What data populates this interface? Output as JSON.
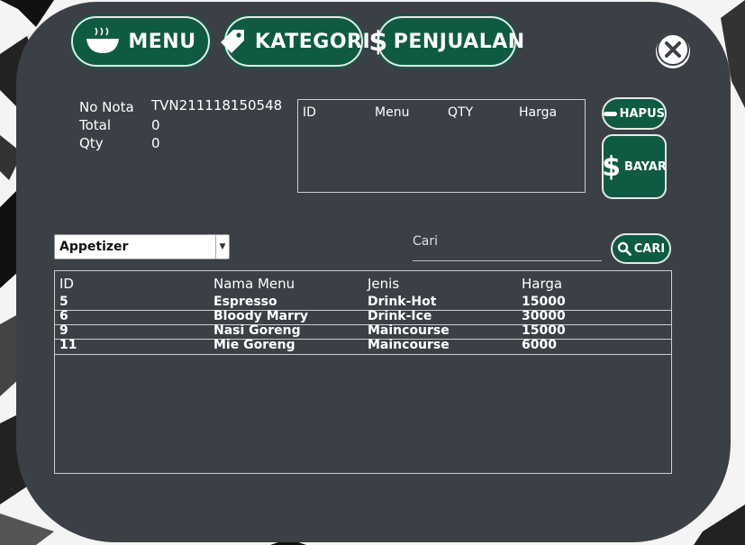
{
  "nav": {
    "menu_label": "MENU",
    "kategori_label": "KATEGORI",
    "penjualan_label": "PENJUALAN"
  },
  "info": {
    "no_nota_label": "No Nota",
    "no_nota_value": "TVN211118150548",
    "total_label": "Total",
    "total_value": "0",
    "qty_label": "Qty",
    "qty_value": "0"
  },
  "cart": {
    "columns": [
      "ID",
      "Menu",
      "QTY",
      "Harga"
    ]
  },
  "actions": {
    "hapus_label": "HAPUS",
    "bayar_label": "BAYAR",
    "cari_label": "CARI"
  },
  "filter": {
    "selected": "Appetizer"
  },
  "search": {
    "placeholder": "Cari"
  },
  "menu_table": {
    "columns": [
      "ID",
      "Nama Menu",
      "Jenis",
      "Harga"
    ],
    "rows": [
      [
        "5",
        "Espresso",
        "Drink-Hot",
        "15000"
      ],
      [
        "6",
        "Bloody Marry",
        "Drink-Ice",
        "30000"
      ],
      [
        "9",
        "Nasi Goreng",
        "Maincourse",
        "15000"
      ],
      [
        "11",
        "Mie Goreng",
        "Maincourse",
        "6000"
      ]
    ]
  },
  "colors": {
    "panel": "#3b3f46",
    "accent_green": "#0f5a43",
    "text": "#ffffff"
  }
}
